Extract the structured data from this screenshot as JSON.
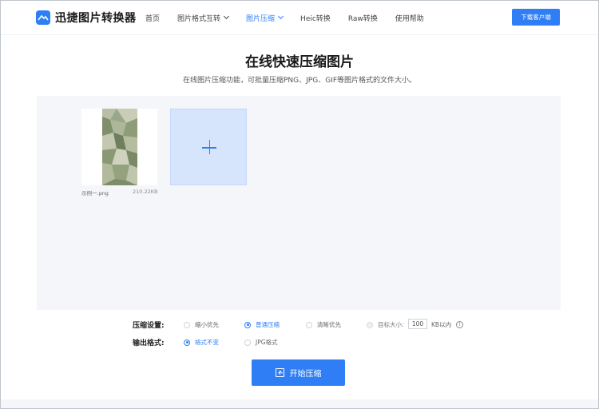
{
  "app": {
    "name": "迅捷图片转换器",
    "brand_color": "#2f7ef6"
  },
  "nav": {
    "items": [
      {
        "label": "首页",
        "has_dropdown": false,
        "active": false
      },
      {
        "label": "图片格式互转",
        "has_dropdown": true,
        "active": false
      },
      {
        "label": "图片压缩",
        "has_dropdown": true,
        "active": true
      },
      {
        "label": "Heic转换",
        "has_dropdown": false,
        "active": false
      },
      {
        "label": "Raw转换",
        "has_dropdown": false,
        "active": false
      },
      {
        "label": "使用帮助",
        "has_dropdown": false,
        "active": false
      }
    ],
    "download_label": "下载客户端"
  },
  "page": {
    "title": "在线快速压缩图片",
    "subtitle": "在线图片压缩功能，可批量压缩PNG、JPG、GIF等图片格式的文件大小。"
  },
  "files": [
    {
      "name": "示例一.png",
      "size": "210.22KB"
    }
  ],
  "settings": {
    "compress_label": "压缩设置:",
    "compress_options": [
      {
        "label": "缩小优先",
        "selected": false
      },
      {
        "label": "普通压缩",
        "selected": true
      },
      {
        "label": "清晰优先",
        "selected": false
      },
      {
        "label": "目标大小:",
        "selected": false
      }
    ],
    "target_size_value": "100",
    "target_size_unit": "KB以内",
    "info_icon": "i",
    "output_label": "输出格式:",
    "output_options": [
      {
        "label": "格式不变",
        "selected": true
      },
      {
        "label": "JPG格式",
        "selected": false
      }
    ]
  },
  "actions": {
    "start_label": "开始压缩"
  }
}
